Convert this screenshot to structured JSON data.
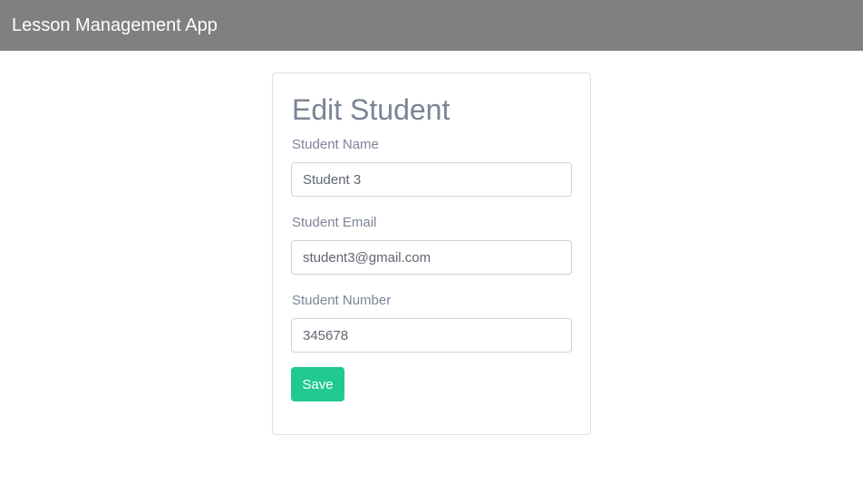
{
  "navbar": {
    "brand": "Lesson Management App"
  },
  "form": {
    "title": "Edit Student",
    "fields": [
      {
        "label": "Student Name",
        "value": "Student 3"
      },
      {
        "label": "Student Email",
        "value": "student3@gmail.com"
      },
      {
        "label": "Student Number",
        "value": "345678"
      }
    ],
    "save_label": "Save"
  },
  "colors": {
    "navbar_bg": "#808080",
    "accent": "#20c98d",
    "label_text": "#7c8496"
  }
}
